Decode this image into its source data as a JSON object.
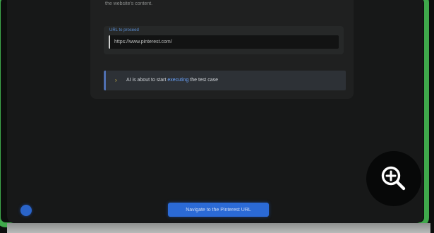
{
  "card": {
    "top_text": "the website's content."
  },
  "url_field": {
    "label": "URL to proceed",
    "value": "https://www.pinterest.com/"
  },
  "notice": {
    "icon": "chevron-right-icon",
    "prefix": "AI is about to start ",
    "highlight": "executing",
    "suffix": " the test case"
  },
  "actions": {
    "navigate_label": "Navigate to the Pinterest URL",
    "zoom_icon": "zoom-in-icon",
    "help_icon": "info-dot-icon"
  },
  "colors": {
    "frame": "#3fa84b",
    "accent": "#2b6ad6",
    "warning": "#e2c64b",
    "background": "#171818"
  }
}
